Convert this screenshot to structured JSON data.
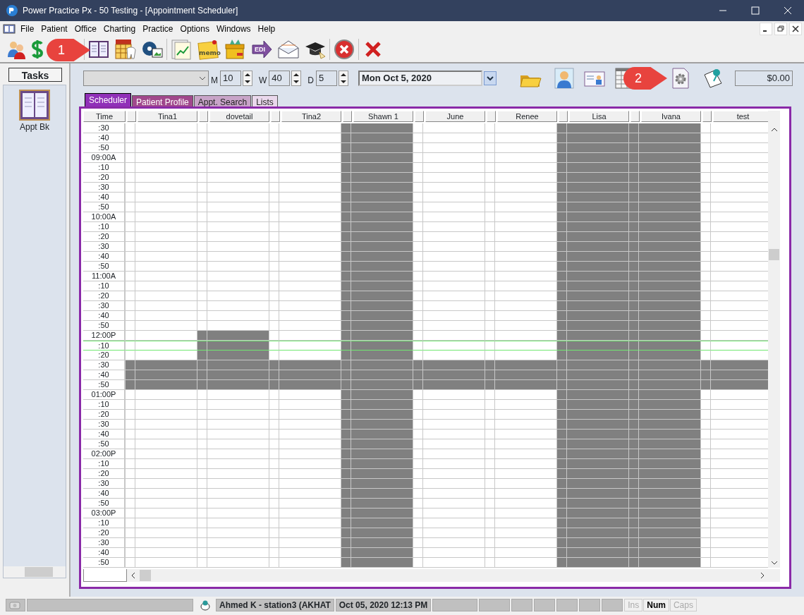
{
  "window": {
    "title": "Power Practice Px - 50 Testing - [Appointment Scheduler]"
  },
  "menu": [
    "File",
    "Patient",
    "Office",
    "Charting",
    "Practice",
    "Options",
    "Windows",
    "Help"
  ],
  "toolbar": {
    "memo_label": "memo",
    "edi_label": "EDI"
  },
  "callouts": [
    {
      "label": "1"
    },
    {
      "label": "2"
    }
  ],
  "tasks": {
    "title": "Tasks",
    "items": [
      {
        "label": "Appt Bk"
      }
    ]
  },
  "controls": {
    "m_label": "M",
    "m_value": "10",
    "w_label": "W",
    "w_value": "40",
    "d_label": "D",
    "d_value": "5",
    "date": "Mon  Oct 5, 2020",
    "balance": "$0.00"
  },
  "tabs": [
    {
      "label": "Scheduler",
      "selected": true,
      "color": "#9030b8"
    },
    {
      "label": "Patient Profile",
      "selected": false,
      "color": "#a0488c"
    },
    {
      "label": "Appt. Search",
      "selected": false,
      "color": "#c8a4c8"
    },
    {
      "label": "Lists",
      "selected": false,
      "color": "#ead8ec"
    }
  ],
  "schedule": {
    "time_header": "Time",
    "columns": [
      "Tina1",
      "dovetail",
      "Tina2",
      "Shawn 1",
      "June",
      "Renee",
      "Lisa",
      "Ivana",
      "test"
    ],
    "rows": [
      {
        "time": ":30",
        "selected": false,
        "blocked": [
          false,
          false,
          false,
          true,
          false,
          false,
          true,
          true,
          false
        ]
      },
      {
        "time": ":40",
        "selected": false,
        "blocked": [
          false,
          false,
          false,
          true,
          false,
          false,
          true,
          true,
          false
        ]
      },
      {
        "time": ":50",
        "selected": false,
        "blocked": [
          false,
          false,
          false,
          true,
          false,
          false,
          true,
          true,
          false
        ]
      },
      {
        "time": "09:00A",
        "selected": false,
        "blocked": [
          false,
          false,
          false,
          true,
          false,
          false,
          true,
          true,
          false
        ]
      },
      {
        "time": ":10",
        "selected": false,
        "blocked": [
          false,
          false,
          false,
          true,
          false,
          false,
          true,
          true,
          false
        ]
      },
      {
        "time": ":20",
        "selected": false,
        "blocked": [
          false,
          false,
          false,
          true,
          false,
          false,
          true,
          true,
          false
        ]
      },
      {
        "time": ":30",
        "selected": false,
        "blocked": [
          false,
          false,
          false,
          true,
          false,
          false,
          true,
          true,
          false
        ]
      },
      {
        "time": ":40",
        "selected": false,
        "blocked": [
          false,
          false,
          false,
          true,
          false,
          false,
          true,
          true,
          false
        ]
      },
      {
        "time": ":50",
        "selected": false,
        "blocked": [
          false,
          false,
          false,
          true,
          false,
          false,
          true,
          true,
          false
        ]
      },
      {
        "time": "10:00A",
        "selected": false,
        "blocked": [
          false,
          false,
          false,
          true,
          false,
          false,
          true,
          true,
          false
        ]
      },
      {
        "time": ":10",
        "selected": false,
        "blocked": [
          false,
          false,
          false,
          true,
          false,
          false,
          true,
          true,
          false
        ]
      },
      {
        "time": ":20",
        "selected": false,
        "blocked": [
          false,
          false,
          false,
          true,
          false,
          false,
          true,
          true,
          false
        ]
      },
      {
        "time": ":30",
        "selected": false,
        "blocked": [
          false,
          false,
          false,
          true,
          false,
          false,
          true,
          true,
          false
        ]
      },
      {
        "time": ":40",
        "selected": false,
        "blocked": [
          false,
          false,
          false,
          true,
          false,
          false,
          true,
          true,
          false
        ]
      },
      {
        "time": ":50",
        "selected": false,
        "blocked": [
          false,
          false,
          false,
          true,
          false,
          false,
          true,
          true,
          false
        ]
      },
      {
        "time": "11:00A",
        "selected": false,
        "blocked": [
          false,
          false,
          false,
          true,
          false,
          false,
          true,
          true,
          false
        ]
      },
      {
        "time": ":10",
        "selected": false,
        "blocked": [
          false,
          false,
          false,
          true,
          false,
          false,
          true,
          true,
          false
        ]
      },
      {
        "time": ":20",
        "selected": false,
        "blocked": [
          false,
          false,
          false,
          true,
          false,
          false,
          true,
          true,
          false
        ]
      },
      {
        "time": ":30",
        "selected": false,
        "blocked": [
          false,
          false,
          false,
          true,
          false,
          false,
          true,
          true,
          false
        ]
      },
      {
        "time": ":40",
        "selected": false,
        "blocked": [
          false,
          false,
          false,
          true,
          false,
          false,
          true,
          true,
          false
        ]
      },
      {
        "time": ":50",
        "selected": false,
        "blocked": [
          false,
          false,
          false,
          true,
          false,
          false,
          true,
          true,
          false
        ]
      },
      {
        "time": "12:00P",
        "selected": false,
        "blocked": [
          false,
          true,
          false,
          true,
          false,
          false,
          true,
          true,
          false
        ]
      },
      {
        "time": ":10",
        "selected": true,
        "blocked": [
          false,
          true,
          false,
          true,
          false,
          false,
          true,
          true,
          false
        ]
      },
      {
        "time": ":20",
        "selected": false,
        "blocked": [
          false,
          true,
          false,
          true,
          false,
          false,
          true,
          true,
          false
        ]
      },
      {
        "time": ":30",
        "selected": false,
        "blocked": [
          true,
          true,
          true,
          true,
          true,
          true,
          true,
          true,
          true
        ]
      },
      {
        "time": ":40",
        "selected": false,
        "blocked": [
          true,
          true,
          true,
          true,
          true,
          true,
          true,
          true,
          true
        ]
      },
      {
        "time": ":50",
        "selected": false,
        "blocked": [
          true,
          true,
          true,
          true,
          true,
          true,
          true,
          true,
          true
        ]
      },
      {
        "time": "01:00P",
        "selected": false,
        "blocked": [
          false,
          false,
          false,
          true,
          false,
          false,
          true,
          true,
          false
        ]
      },
      {
        "time": ":10",
        "selected": false,
        "blocked": [
          false,
          false,
          false,
          true,
          false,
          false,
          true,
          true,
          false
        ]
      },
      {
        "time": ":20",
        "selected": false,
        "blocked": [
          false,
          false,
          false,
          true,
          false,
          false,
          true,
          true,
          false
        ]
      },
      {
        "time": ":30",
        "selected": false,
        "blocked": [
          false,
          false,
          false,
          true,
          false,
          false,
          true,
          true,
          false
        ]
      },
      {
        "time": ":40",
        "selected": false,
        "blocked": [
          false,
          false,
          false,
          true,
          false,
          false,
          true,
          true,
          false
        ]
      },
      {
        "time": ":50",
        "selected": false,
        "blocked": [
          false,
          false,
          false,
          true,
          false,
          false,
          true,
          true,
          false
        ]
      },
      {
        "time": "02:00P",
        "selected": false,
        "blocked": [
          false,
          false,
          false,
          true,
          false,
          false,
          true,
          true,
          false
        ]
      },
      {
        "time": ":10",
        "selected": false,
        "blocked": [
          false,
          false,
          false,
          true,
          false,
          false,
          true,
          true,
          false
        ]
      },
      {
        "time": ":20",
        "selected": false,
        "blocked": [
          false,
          false,
          false,
          true,
          false,
          false,
          true,
          true,
          false
        ]
      },
      {
        "time": ":30",
        "selected": false,
        "blocked": [
          false,
          false,
          false,
          true,
          false,
          false,
          true,
          true,
          false
        ]
      },
      {
        "time": ":40",
        "selected": false,
        "blocked": [
          false,
          false,
          false,
          true,
          false,
          false,
          true,
          true,
          false
        ]
      },
      {
        "time": ":50",
        "selected": false,
        "blocked": [
          false,
          false,
          false,
          true,
          false,
          false,
          true,
          true,
          false
        ]
      },
      {
        "time": "03:00P",
        "selected": false,
        "blocked": [
          false,
          false,
          false,
          true,
          false,
          false,
          true,
          true,
          false
        ]
      },
      {
        "time": ":10",
        "selected": false,
        "blocked": [
          false,
          false,
          false,
          true,
          false,
          false,
          true,
          true,
          false
        ]
      },
      {
        "time": ":20",
        "selected": false,
        "blocked": [
          false,
          false,
          false,
          true,
          false,
          false,
          true,
          true,
          false
        ]
      },
      {
        "time": ":30",
        "selected": false,
        "blocked": [
          false,
          false,
          false,
          true,
          false,
          false,
          true,
          true,
          false
        ]
      },
      {
        "time": ":40",
        "selected": false,
        "blocked": [
          false,
          false,
          false,
          true,
          false,
          false,
          true,
          true,
          false
        ]
      },
      {
        "time": ":50",
        "selected": false,
        "blocked": [
          false,
          false,
          false,
          true,
          false,
          false,
          true,
          true,
          false
        ]
      }
    ]
  },
  "status_bar": {
    "user": "Ahmed K - station3 (AKHAT",
    "datetime": "Oct 05, 2020 12:13 PM",
    "keys": [
      {
        "label": "Ins",
        "on": false
      },
      {
        "label": "Num",
        "on": true
      },
      {
        "label": "Caps",
        "on": false
      }
    ]
  }
}
